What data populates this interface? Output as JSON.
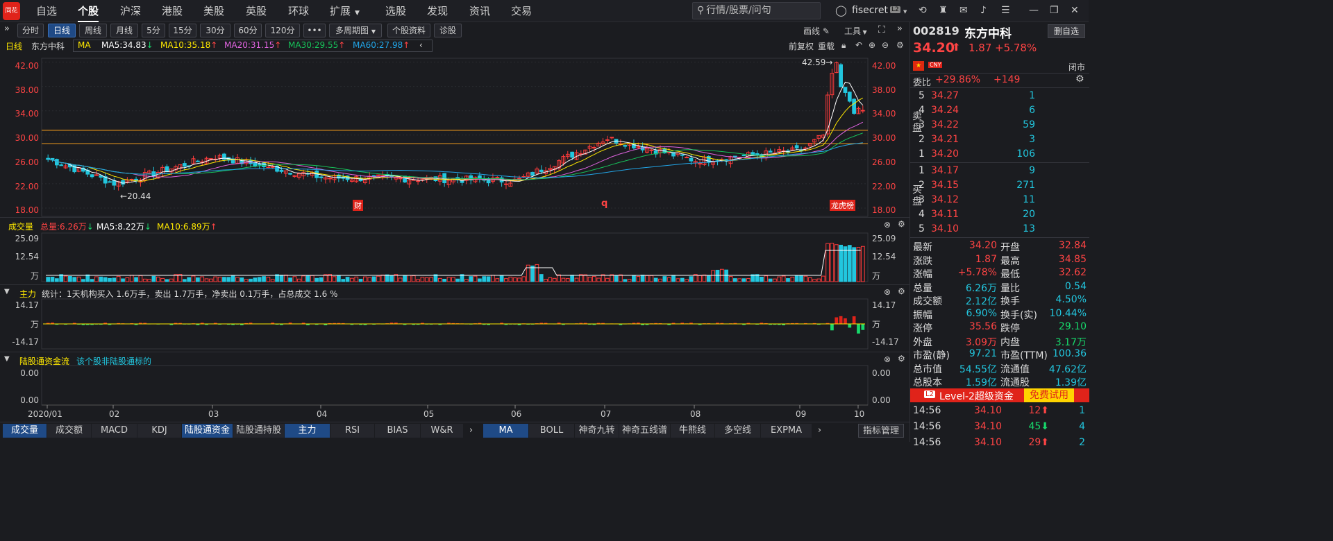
{
  "topnav": {
    "logo": "同花顺",
    "items": [
      "自选",
      "个股",
      "沪深",
      "港股",
      "美股",
      "英股",
      "环球",
      "扩展",
      "选股",
      "发现",
      "资讯",
      "交易"
    ],
    "search_placeholder": "行情/股票/问句",
    "user": "fisecret",
    "user_badge": "L2"
  },
  "periods": [
    "分时",
    "日线",
    "周线",
    "月线",
    "5分",
    "15分",
    "30分",
    "60分",
    "120分",
    "•••",
    "多周期图",
    "个股资料",
    "诊股"
  ],
  "active_period": "日线",
  "tools": {
    "draw": "画线",
    "tools": "工具"
  },
  "ma_line": {
    "period": "日线",
    "name": "东方中科",
    "indicator": "MA",
    "items": [
      {
        "label": "MA5:34.83",
        "dir": "down",
        "color": "#ffffff"
      },
      {
        "label": "MA10:35.18",
        "dir": "up",
        "color": "#ffe900"
      },
      {
        "label": "MA20:31.15",
        "dir": "up",
        "color": "#e064e0"
      },
      {
        "label": "MA30:29.55",
        "dir": "up",
        "color": "#17c25a"
      },
      {
        "label": "MA60:27.98",
        "dir": "up",
        "color": "#22a6e8"
      }
    ],
    "fq": "前复权",
    "cq": "重载"
  },
  "price_axis": [
    "42.00",
    "38.00",
    "34.00",
    "30.00",
    "26.00",
    "22.00",
    "18.00"
  ],
  "annotations": {
    "high": "42.59",
    "low": "20.44",
    "markers": [
      "财",
      "q",
      "龙虎榜"
    ]
  },
  "volume": {
    "title": "成交量",
    "total": "总量:6.26万",
    "ma5": "MA5:8.22万",
    "ma10": "MA10:6.89万",
    "axis": [
      "25.09",
      "12.54",
      "万"
    ]
  },
  "main_force": {
    "title": "主力",
    "stat": "统计：1天机构买入 1.6万手，卖出 1.7万手，净卖出 0.1万手，占总成交 1.6 %",
    "axis": [
      "14.17",
      "万",
      "-14.17"
    ]
  },
  "hk_flow": {
    "title": "陆股通资金流",
    "note": "该个股非陆股通标的",
    "axis": [
      "0.00",
      "0.00"
    ]
  },
  "x_axis": [
    "2020/01",
    "02",
    "03",
    "04",
    "05",
    "06",
    "07",
    "08",
    "09",
    "10"
  ],
  "bottom_tabs_left": [
    "成交量",
    "成交额",
    "MACD",
    "KDJ",
    "陆股通资金",
    "陆股通持股",
    "主力",
    "RSI",
    "BIAS",
    "W&R"
  ],
  "bottom_tabs_right": [
    "MA",
    "BOLL",
    "神奇九转",
    "神奇五线谱",
    "牛熊线",
    "多空线",
    "EXPMA",
    "指标管理"
  ],
  "quote": {
    "code": "002819",
    "name": "东方中科",
    "delete_btn": "删自选",
    "price": "34.20",
    "change": "1.87",
    "pct": "+5.78%",
    "currency": "CNY",
    "status": "闭市",
    "weibi_label": "委比",
    "weibi": "+29.86%",
    "weicha": "+149",
    "sell_label": "卖盘",
    "buy_label": "买盘",
    "sell": [
      {
        "lvl": "5",
        "price": "34.27",
        "vol": "1"
      },
      {
        "lvl": "4",
        "price": "34.24",
        "vol": "6"
      },
      {
        "lvl": "3",
        "price": "34.22",
        "vol": "59"
      },
      {
        "lvl": "2",
        "price": "34.21",
        "vol": "3"
      },
      {
        "lvl": "1",
        "price": "34.20",
        "vol": "106"
      }
    ],
    "buy": [
      {
        "lvl": "1",
        "price": "34.17",
        "vol": "9"
      },
      {
        "lvl": "2",
        "price": "34.15",
        "vol": "271"
      },
      {
        "lvl": "3",
        "price": "34.12",
        "vol": "11"
      },
      {
        "lvl": "4",
        "price": "34.11",
        "vol": "20"
      },
      {
        "lvl": "5",
        "price": "34.10",
        "vol": "13"
      }
    ],
    "stats": [
      {
        "l1": "最新",
        "v1": "34.20",
        "c1": "red",
        "l2": "开盘",
        "v2": "32.84",
        "c2": "red"
      },
      {
        "l1": "涨跌",
        "v1": "1.87",
        "c1": "red",
        "l2": "最高",
        "v2": "34.85",
        "c2": "red"
      },
      {
        "l1": "涨幅",
        "v1": "+5.78%",
        "c1": "red",
        "l2": "最低",
        "v2": "32.62",
        "c2": "red"
      },
      {
        "l1": "总量",
        "v1": "6.26万",
        "c1": "cyan",
        "l2": "量比",
        "v2": "0.54",
        "c2": "cyan"
      },
      {
        "l1": "成交额",
        "v1": "2.12亿",
        "c1": "cyan",
        "l2": "换手",
        "v2": "4.50%",
        "c2": "cyan"
      },
      {
        "l1": "振幅",
        "v1": "6.90%",
        "c1": "cyan",
        "l2": "换手(实)",
        "v2": "10.44%",
        "c2": "cyan"
      },
      {
        "l1": "涨停",
        "v1": "35.56",
        "c1": "red",
        "l2": "跌停",
        "v2": "29.10",
        "c2": "green"
      },
      {
        "l1": "外盘",
        "v1": "3.09万",
        "c1": "red",
        "l2": "内盘",
        "v2": "3.17万",
        "c2": "green"
      },
      {
        "l1": "市盈(静)",
        "v1": "97.21",
        "c1": "cyan",
        "l2": "市盈(TTM)",
        "v2": "100.36",
        "c2": "cyan"
      },
      {
        "l1": "总市值",
        "v1": "54.55亿",
        "c1": "cyan",
        "l2": "流通值",
        "v2": "47.62亿",
        "c2": "cyan"
      },
      {
        "l1": "总股本",
        "v1": "1.59亿",
        "c1": "cyan",
        "l2": "流通股",
        "v2": "1.39亿",
        "c2": "cyan"
      }
    ],
    "l2_badge": "L2",
    "l2_text": "Level-2超级资金",
    "free_trial": "免费试用",
    "ticks": [
      {
        "time": "14:56",
        "price": "34.10",
        "vol": "12",
        "dir": "up",
        "n": "1"
      },
      {
        "time": "14:56",
        "price": "34.10",
        "vol": "45",
        "dir": "down",
        "n": "4"
      },
      {
        "time": "14:56",
        "price": "34.10",
        "vol": "29",
        "dir": "up",
        "n": "2"
      }
    ]
  },
  "chart_data": {
    "type": "candlestick",
    "ylim": [
      18,
      44
    ],
    "approx_closes_monthly": [
      {
        "x": "2020/01",
        "close": 26.0
      },
      {
        "x": "02",
        "close": 22.0
      },
      {
        "x": "03",
        "close": 26.5
      },
      {
        "x": "04",
        "close": 23.0
      },
      {
        "x": "05",
        "close": 22.8
      },
      {
        "x": "06",
        "close": 22.5
      },
      {
        "x": "07",
        "close": 29.5
      },
      {
        "x": "08",
        "close": 25.8
      },
      {
        "x": "09",
        "close": 27.5
      },
      {
        "x": "10",
        "close": 34.2
      }
    ],
    "horizontal_lines": [
      30.8,
      28.6
    ]
  },
  "colors": {
    "up": "#ff3b3b",
    "down": "#22c6de",
    "ma5": "#ffffff",
    "ma10": "#ffe900",
    "ma20": "#e064e0",
    "ma30": "#17c25a",
    "ma60": "#22a6e8",
    "hline": "#d98b1c"
  }
}
